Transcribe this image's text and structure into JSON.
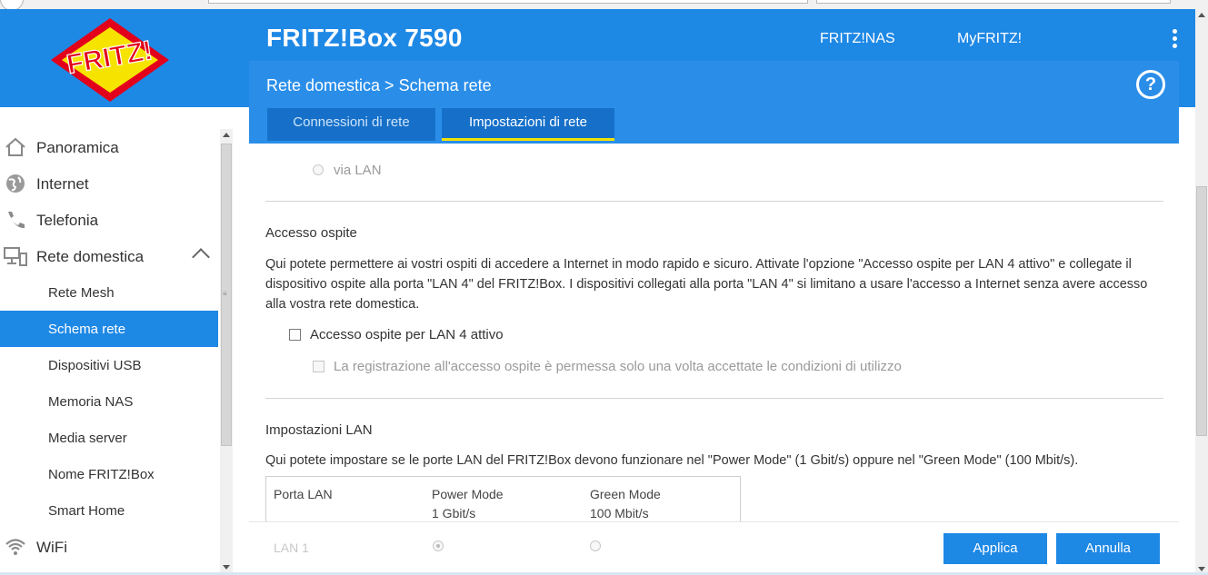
{
  "header": {
    "product_name": "FRITZ!Box 7590",
    "links": [
      "FRITZ!NAS",
      "MyFRITZ!"
    ],
    "logo_text": "FRITZ!"
  },
  "content_header": {
    "breadcrumb": "Rete domestica > Schema rete",
    "help_label": "?",
    "tabs": [
      {
        "label": "Connessioni di rete",
        "active": false
      },
      {
        "label": "Impostazioni di rete",
        "active": true
      }
    ]
  },
  "sidebar": {
    "items": [
      {
        "label": "Panoramica",
        "icon": "home-icon"
      },
      {
        "label": "Internet",
        "icon": "globe-icon"
      },
      {
        "label": "Telefonia",
        "icon": "phone-icon"
      },
      {
        "label": "Rete domestica",
        "icon": "network-icon",
        "expanded": true
      },
      {
        "label": "Rete Mesh"
      },
      {
        "label": "Schema rete",
        "active": true
      },
      {
        "label": "Dispositivi USB"
      },
      {
        "label": "Memoria NAS"
      },
      {
        "label": "Media server"
      },
      {
        "label": "Nome FRITZ!Box"
      },
      {
        "label": "Smart Home"
      },
      {
        "label": "WiFi",
        "icon": "wifi-icon"
      }
    ]
  },
  "main": {
    "via_lan_label": "via LAN",
    "guest": {
      "title": "Accesso ospite",
      "description": "Qui potete permettere ai vostri ospiti di accedere a Internet in modo rapido e sicuro. Attivate l'opzione \"Accesso ospite per LAN 4 attivo\" e collegate il dispositivo ospite alla porta \"LAN 4\" del FRITZ!Box. I dispositivi collegati alla porta \"LAN 4\" si limitano a usare l'accesso a Internet senza avere accesso alla vostra rete domestica.",
      "checkbox_label": "Accesso ospite per LAN 4 attivo",
      "sub_checkbox_label": "La registrazione all'accesso ospite è permessa solo una volta accettate le condizioni di utilizzo"
    },
    "lan": {
      "title": "Impostazioni LAN",
      "description": "Qui potete impostare se le porte LAN del FRITZ!Box devono funzionare nel \"Power Mode\" (1 Gbit/s) oppure nel \"Green Mode\" (100 Mbit/s).",
      "table_headers": [
        {
          "line1": "Porta LAN",
          "line2": ""
        },
        {
          "line1": "Power Mode",
          "line2": "1 Gbit/s"
        },
        {
          "line1": "Green Mode",
          "line2": "100 Mbit/s"
        }
      ],
      "first_row_label": "LAN 1"
    }
  },
  "footer": {
    "apply_label": "Applica",
    "cancel_label": "Annulla"
  },
  "colors": {
    "brand_blue": "#1e88e5",
    "tab_highlight": "#f2e300"
  }
}
